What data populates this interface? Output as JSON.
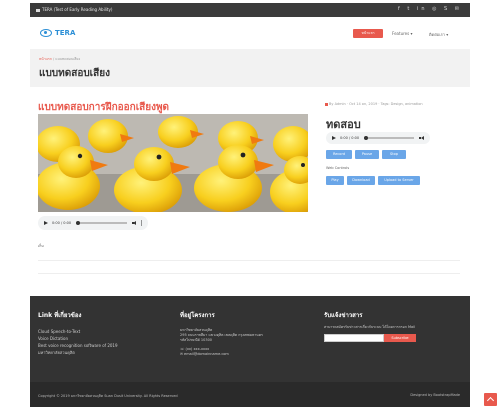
{
  "topbar": {
    "brand": "TERA (Test of Early Reading Ability)",
    "social_icons": [
      "facebook-icon",
      "twitter-icon",
      "linkedin-icon",
      "instagram-icon",
      "skype-icon",
      "mail-icon"
    ],
    "social_glyphs": "f  t  in  ◎  S  ✉"
  },
  "nav": {
    "logo_text": "TERA",
    "home_button": "หน้าแรก",
    "item1": "Features ▾",
    "item2": "ติดต่อเรา ▾"
  },
  "crumbs": {
    "home": "หน้าแรก",
    "separator": " / ",
    "current": "แบบทดสอบเสียง",
    "title": "แบบทดสอบเสียง"
  },
  "article": {
    "heading": "แบบทดสอบการฝึกออกเสียงพูด",
    "meta": "By Admin · Oct 14 on, 2019 · Tags: Design, animation",
    "audio_time": "0:00 / 0:00",
    "tag": "เก็บ"
  },
  "side": {
    "title": "ทดสอบ",
    "audio_time": "0:00 / 0:00",
    "buttons": [
      "Record",
      "Pause",
      "Stop"
    ],
    "label": "Web Controls",
    "buttons2": [
      "Play",
      "Download",
      "Upload to Server"
    ]
  },
  "footer": {
    "col1_title": "Link ที่เกี่ยวข้อง",
    "col1_links": [
      "Cloud Speech-to-Text",
      "Voice Dictation",
      "Best voice recognition software of 2019",
      "มหาวิทยาลัยสวนดุสิต"
    ],
    "col2_title": "ที่อยู่โครงการ",
    "col2_lines": [
      "มหาวิทยาลัยสวนดุสิต",
      "295 ถนนราชสีมา แขวงดุสิต เขตดุสิต กรุงเทพมหานคร",
      "รหัสไปรษณีย์ 10300"
    ],
    "col2_phone": "☏ (xx) xxx-xxxx",
    "col2_email": "✉ email@domainname.com",
    "col3_title": "รับแจ้งข่าวสาร",
    "col3_text": "สามารถสมัครรับข่าวสารเกี่ยวกับระบบ ได้โดยการกรอก Mail",
    "subscribe_placeholder": "",
    "subscribe_button": "Subscribe"
  },
  "copyright": {
    "left": "Copyright © 2019 มหาวิทยาลัยสวนดุสิต Suan Dusit University. All Rights Reserved",
    "right": "Designed by BootstrapMade"
  }
}
